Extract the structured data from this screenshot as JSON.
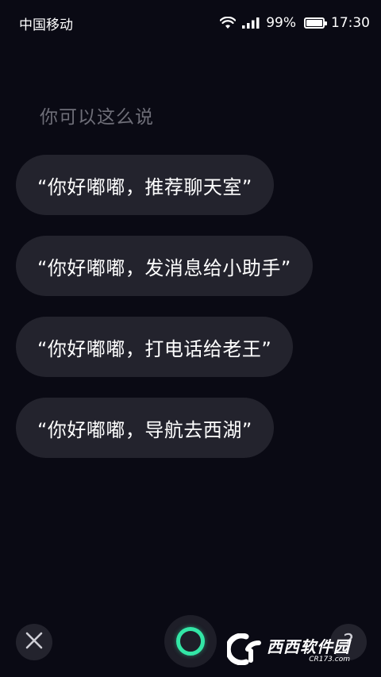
{
  "status_bar": {
    "carrier": "中国移动",
    "battery_percent": "99%",
    "battery_level": 0.99,
    "time": "17:30",
    "icons": [
      "wifi-icon",
      "signal-icon",
      "battery-icon"
    ]
  },
  "prompt": {
    "title": "你可以这么说"
  },
  "suggestions": [
    {
      "label": "“你好嘟嘟，推荐聊天室”"
    },
    {
      "label": "“你好嘟嘟，发消息给小助手”"
    },
    {
      "label": "“你好嘟嘟，打电话给老王”"
    },
    {
      "label": "“你好嘟嘟，导航去西湖”"
    }
  ],
  "controls": {
    "close_icon": "close-icon",
    "mic_icon": "mic-ring-icon",
    "help_label": "?"
  },
  "watermark": {
    "main": "西西软件园",
    "sub": "CR173.com"
  },
  "colors": {
    "background": "#0a0a14",
    "pill": "#23232d",
    "prompt_text": "#6e6e78",
    "accent": "#33e6a6"
  }
}
